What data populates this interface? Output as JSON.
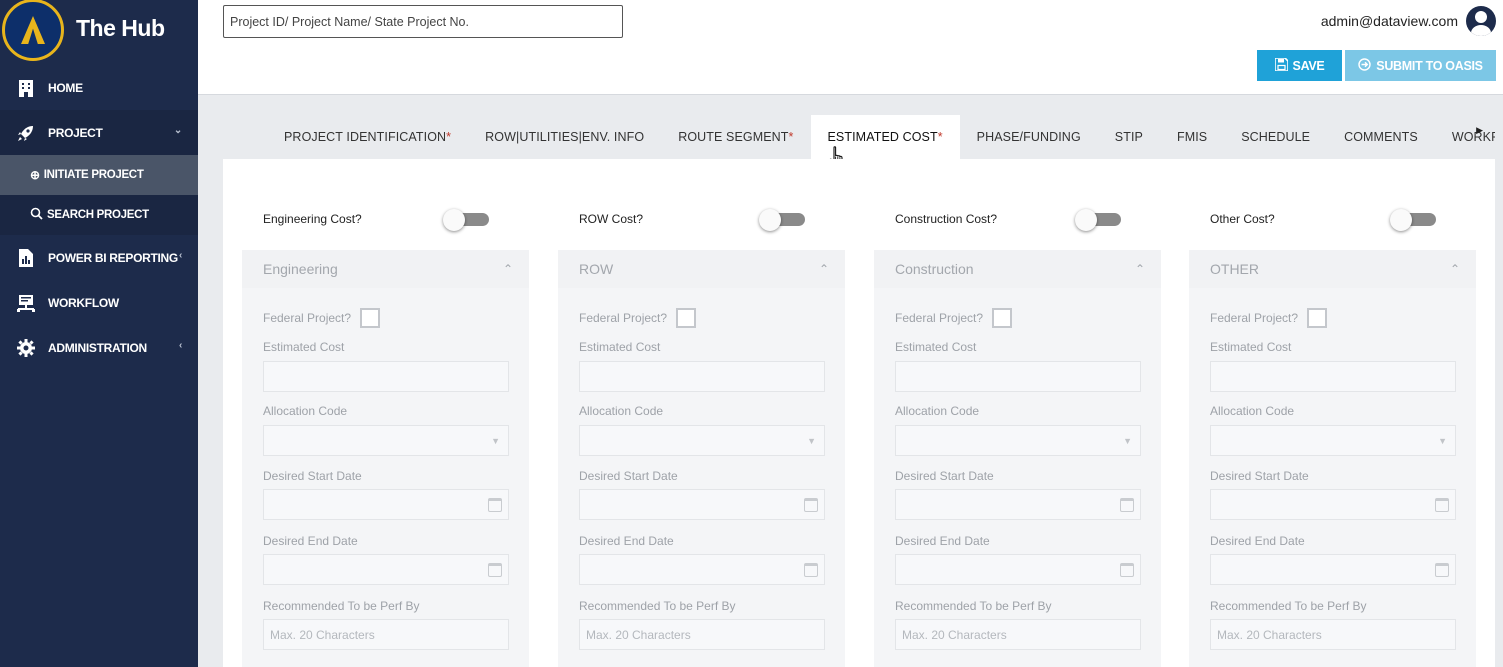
{
  "app": {
    "title": "The Hub"
  },
  "sidebar": {
    "home": "HOME",
    "project": "PROJECT",
    "initiate": "INITIATE PROJECT",
    "search": "SEARCH PROJECT",
    "powerbi": "POWER BI REPORTING",
    "workflow": "WORKFLOW",
    "administration": "ADMINISTRATION"
  },
  "header": {
    "search_placeholder": "Project ID/ Project Name/ State Project No.",
    "user_email": "admin@dataview.com",
    "save_label": "SAVE",
    "submit_label": "SUBMIT TO OASIS"
  },
  "tabs": [
    {
      "label": "PROJECT IDENTIFICATION",
      "req": "*"
    },
    {
      "label": "ROW|UTILITIES|ENV. INFO",
      "req": ""
    },
    {
      "label": "ROUTE SEGMENT",
      "req": "*"
    },
    {
      "label": "ESTIMATED COST",
      "req": "*"
    },
    {
      "label": "PHASE/FUNDING",
      "req": ""
    },
    {
      "label": "STIP",
      "req": ""
    },
    {
      "label": "FMIS",
      "req": ""
    },
    {
      "label": "SCHEDULE",
      "req": ""
    },
    {
      "label": "COMMENTS",
      "req": ""
    },
    {
      "label": "WORKF",
      "req": ""
    }
  ],
  "columns": [
    {
      "toggle": "Engineering Cost?",
      "panel": "Engineering"
    },
    {
      "toggle": "ROW Cost?",
      "panel": "ROW"
    },
    {
      "toggle": "Construction Cost?",
      "panel": "Construction"
    },
    {
      "toggle": "Other Cost?",
      "panel": "OTHER"
    }
  ],
  "form": {
    "federal": "Federal Project?",
    "estimated_cost": "Estimated Cost",
    "allocation_code": "Allocation Code",
    "start_date": "Desired Start Date",
    "end_date": "Desired End Date",
    "recommended": "Recommended To be Perf By",
    "recommended_placeholder": "Max. 20 Characters"
  }
}
